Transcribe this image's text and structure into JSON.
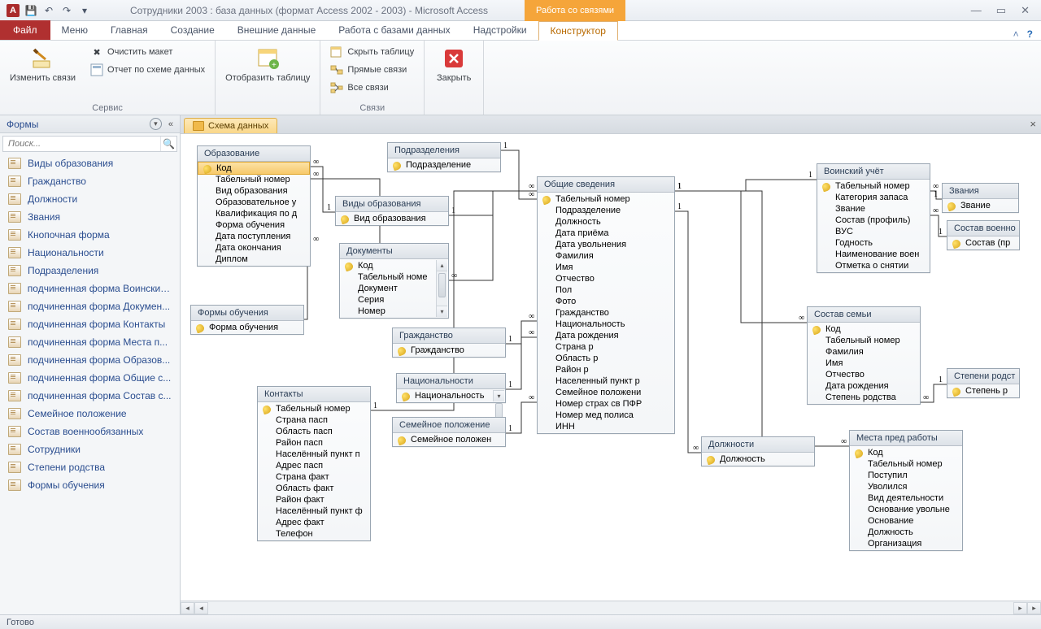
{
  "titlebar": {
    "app_initial": "A",
    "title": "Сотрудники 2003 : база данных (формат Access 2002 - 2003)  -  Microsoft Access",
    "context_tab": "Работа со связями"
  },
  "tabs": {
    "file": "Файл",
    "items": [
      "Меню",
      "Главная",
      "Создание",
      "Внешние данные",
      "Работа с базами данных",
      "Надстройки"
    ],
    "active": "Конструктор"
  },
  "ribbon": {
    "group1": {
      "label": "Сервис",
      "edit_links": "Изменить связи",
      "clear_layout": "Очистить макет",
      "schema_report": "Отчет по схеме данных"
    },
    "group2": {
      "label": "",
      "show_table": "Отобразить таблицу"
    },
    "group3": {
      "label": "Связи",
      "hide_table": "Скрыть таблицу",
      "direct_links": "Прямые связи",
      "all_links": "Все связи"
    },
    "group4": {
      "label": "",
      "close": "Закрыть"
    }
  },
  "nav": {
    "header": "Формы",
    "search_placeholder": "Поиск...",
    "items": [
      "Виды образования",
      "Гражданство",
      "Должности",
      "Звания",
      "Кнопочная форма",
      "Национальности",
      "Подразделения",
      "подчиненная форма Воинский...",
      "подчиненная форма Докумен...",
      "подчиненная форма Контакты",
      "подчиненная форма Места п...",
      "подчиненная форма Образов...",
      "подчиненная форма Общие с...",
      "подчиненная форма Состав с...",
      "Семейное положение",
      "Состав военнообязанных",
      "Сотрудники",
      "Степени родства",
      "Формы обучения"
    ]
  },
  "doc": {
    "tab": "Схема данных"
  },
  "tables": {
    "education": {
      "title": "Образование",
      "fields": [
        {
          "n": "Код",
          "k": true,
          "sel": true
        },
        {
          "n": "Табельный номер"
        },
        {
          "n": "Вид образования"
        },
        {
          "n": "Образовательное у"
        },
        {
          "n": "Квалификация по д"
        },
        {
          "n": "Форма обучения"
        },
        {
          "n": "Дата поступления"
        },
        {
          "n": "Дата окончания"
        },
        {
          "n": "Диплом"
        }
      ]
    },
    "edutypes": {
      "title": "Виды образования",
      "fields": [
        {
          "n": "Вид образования",
          "k": true
        }
      ]
    },
    "eduforms": {
      "title": "Формы обучения",
      "fields": [
        {
          "n": "Форма обучения",
          "k": true
        }
      ]
    },
    "documents": {
      "title": "Документы",
      "fields": [
        {
          "n": "Код",
          "k": true
        },
        {
          "n": "Табельный номе"
        },
        {
          "n": "Документ"
        },
        {
          "n": "Серия"
        },
        {
          "n": "Номер"
        }
      ]
    },
    "departments": {
      "title": "Подразделения",
      "fields": [
        {
          "n": "Подразделение",
          "k": true
        }
      ]
    },
    "citizenship": {
      "title": "Гражданство",
      "fields": [
        {
          "n": "Гражданство",
          "k": true
        }
      ]
    },
    "nationality": {
      "title": "Национальности",
      "fields": [
        {
          "n": "Национальность",
          "k": true
        }
      ]
    },
    "marital": {
      "title": "Семейное положение",
      "fields": [
        {
          "n": "Семейное положен",
          "k": true
        }
      ]
    },
    "contacts": {
      "title": "Контакты",
      "fields": [
        {
          "n": "Табельный номер",
          "k": true
        },
        {
          "n": "Страна пасп"
        },
        {
          "n": "Область пасп"
        },
        {
          "n": "Район пасп"
        },
        {
          "n": "Населённый пункт п"
        },
        {
          "n": "Адрес пасп"
        },
        {
          "n": "Страна факт"
        },
        {
          "n": "Область факт"
        },
        {
          "n": "Район факт"
        },
        {
          "n": "Населённый пункт ф"
        },
        {
          "n": "Адрес факт"
        },
        {
          "n": "Телефон"
        }
      ]
    },
    "general": {
      "title": "Общие сведения",
      "fields": [
        {
          "n": "Табельный номер",
          "k": true
        },
        {
          "n": "Подразделение"
        },
        {
          "n": "Должность"
        },
        {
          "n": "Дата приёма"
        },
        {
          "n": "Дата увольнения"
        },
        {
          "n": "Фамилия"
        },
        {
          "n": "Имя"
        },
        {
          "n": "Отчество"
        },
        {
          "n": "Пол"
        },
        {
          "n": "Фото"
        },
        {
          "n": "Гражданство"
        },
        {
          "n": "Национальность"
        },
        {
          "n": "Дата рождения"
        },
        {
          "n": "Страна р"
        },
        {
          "n": "Область р"
        },
        {
          "n": "Район р"
        },
        {
          "n": "Населенный пункт р"
        },
        {
          "n": "Семейное положени"
        },
        {
          "n": "Номер страх св ПФР"
        },
        {
          "n": "Номер мед полиса"
        },
        {
          "n": "ИНН"
        }
      ]
    },
    "positions": {
      "title": "Должности",
      "fields": [
        {
          "n": "Должность",
          "k": true
        }
      ]
    },
    "military": {
      "title": "Воинский учёт",
      "fields": [
        {
          "n": "Табельный номер",
          "k": true
        },
        {
          "n": "Категория запаса"
        },
        {
          "n": "Звание"
        },
        {
          "n": "Состав (профиль)"
        },
        {
          "n": "ВУС"
        },
        {
          "n": "Годность"
        },
        {
          "n": "Наименование воен"
        },
        {
          "n": "Отметка о снятии"
        }
      ]
    },
    "ranks": {
      "title": "Звания",
      "fields": [
        {
          "n": "Звание",
          "k": true
        }
      ]
    },
    "military_comp": {
      "title": "Состав военно",
      "fields": [
        {
          "n": "Состав (пр",
          "k": true
        }
      ]
    },
    "family": {
      "title": "Состав семьи",
      "fields": [
        {
          "n": "Код",
          "k": true
        },
        {
          "n": "Табельный номер"
        },
        {
          "n": "Фамилия"
        },
        {
          "n": "Имя"
        },
        {
          "n": "Отчество"
        },
        {
          "n": "Дата рождения"
        },
        {
          "n": "Степень родства"
        }
      ]
    },
    "kinship": {
      "title": "Степени родст",
      "fields": [
        {
          "n": "Степень р",
          "k": true
        }
      ]
    },
    "prevwork": {
      "title": "Места пред работы",
      "fields": [
        {
          "n": "Код",
          "k": true
        },
        {
          "n": "Табельный номер"
        },
        {
          "n": "Поступил"
        },
        {
          "n": "Уволился"
        },
        {
          "n": "Вид деятельности"
        },
        {
          "n": "Основание увольне"
        },
        {
          "n": "Основание"
        },
        {
          "n": "Должность"
        },
        {
          "n": "Организация"
        }
      ]
    }
  },
  "status": {
    "text": "Готово"
  }
}
